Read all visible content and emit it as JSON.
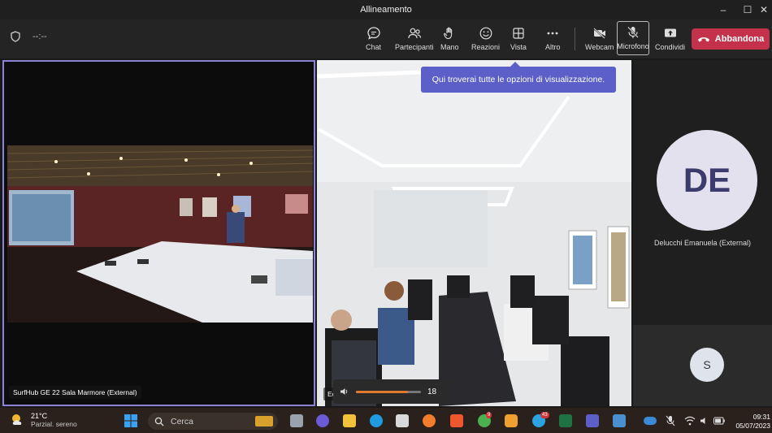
{
  "window": {
    "title": "Allineamento"
  },
  "toolbar": {
    "timer": "--:--",
    "buttons": {
      "chat": "Chat",
      "participants": "Partecipanti",
      "hand": "Mano",
      "reactions": "Reazioni",
      "view": "Vista",
      "more": "Altro",
      "webcam": "Webcam",
      "mic": "Microfono",
      "share": "Condividi",
      "leave": "Abbandona"
    }
  },
  "tooltip": "Qui troverai tutte le opzioni di visualizzazione.",
  "tiles": {
    "left_label": "SurfHub GE 22 Sala Marmore (External)",
    "middle_label": "Ec",
    "volume_value": "18",
    "volume_level": 0.8,
    "participant_de_initials": "DE",
    "participant_de_name": "Delucchi Emanuela (External)",
    "participant_s_initials": "S"
  },
  "taskbar": {
    "temperature": "21°C",
    "weather_text": "Parzial. sereno",
    "search_label": "Cerca",
    "badge_chrome": "9",
    "badge_telegram": "43",
    "time": "09:31",
    "date": "05/07/2023"
  },
  "colors": {
    "accent": "#5b5fc7",
    "leave": "#c4314b",
    "active_border": "#8b83d6"
  }
}
